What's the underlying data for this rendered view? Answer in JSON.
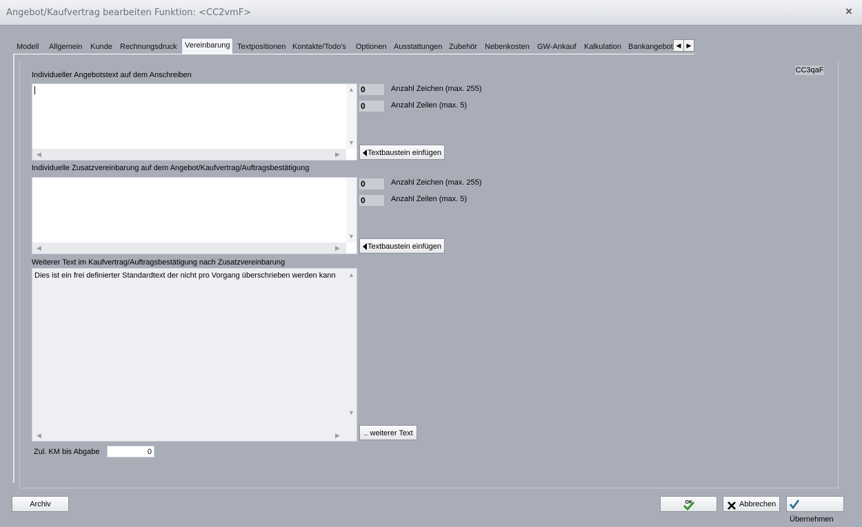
{
  "window": {
    "title": "Angebot/Kaufvertrag bearbeiten   Funktion: <CC2vmF>",
    "close_glyph": "✕"
  },
  "tabs": [
    {
      "label": "Modell"
    },
    {
      "label": "Allgemein"
    },
    {
      "label": "Kunde"
    },
    {
      "label": "Rechnungsdruck"
    },
    {
      "label": "Vereinbarung",
      "active": true
    },
    {
      "label": "Textpositionen"
    },
    {
      "label": "Kontakte/Todo's"
    },
    {
      "label": "Optionen"
    },
    {
      "label": "Ausstattungen"
    },
    {
      "label": "Zubehör"
    },
    {
      "label": "Nebenkosten"
    },
    {
      "label": "GW-Ankauf"
    },
    {
      "label": "Kalkulation"
    },
    {
      "label": "Bankangebot"
    }
  ],
  "tab_scroll": {
    "left": "◀",
    "right": "▶"
  },
  "function_code": "CC3qaF",
  "section1": {
    "label": "Individueller Angebotstext auf dem Anschreiben",
    "text": "",
    "chars_count": "0",
    "chars_label": "Anzahl Zeichen (max. 255)",
    "lines_count": "0",
    "lines_label": "Anzahl Zeilen (max. 5)",
    "insert_button": "Textbaustein einfügen"
  },
  "section2": {
    "label": "Individuelle Zusatzvereinbarung auf dem Angebot/Kaufvertrag/Auftragsbestätigung",
    "text": "",
    "chars_count": "0",
    "chars_label": "Anzahl Zeichen (max. 255)",
    "lines_count": "0",
    "lines_label": "Anzahl Zeilen (max. 5)",
    "insert_button": "Textbaustein einfügen"
  },
  "section3": {
    "label": "Weiterer Text im Kaufvertrag/Auftragsbestätigung nach Zusatzvereinbarung",
    "text": "Dies ist ein frei definierter Standardtext der nicht pro Vorgang überschrieben werden kann",
    "more_button": ".. weiterer Text"
  },
  "km": {
    "label": "Zul. KM bis Abgabe",
    "value": "0"
  },
  "footer": {
    "archive": "Archiv",
    "ok_glyph": "OK",
    "cancel": "Abbrechen",
    "apply": "Übernehmen"
  },
  "colors": {
    "background": "#a9adb8",
    "titlebar": "#e4e6eb",
    "check": "#2e9a2e"
  }
}
